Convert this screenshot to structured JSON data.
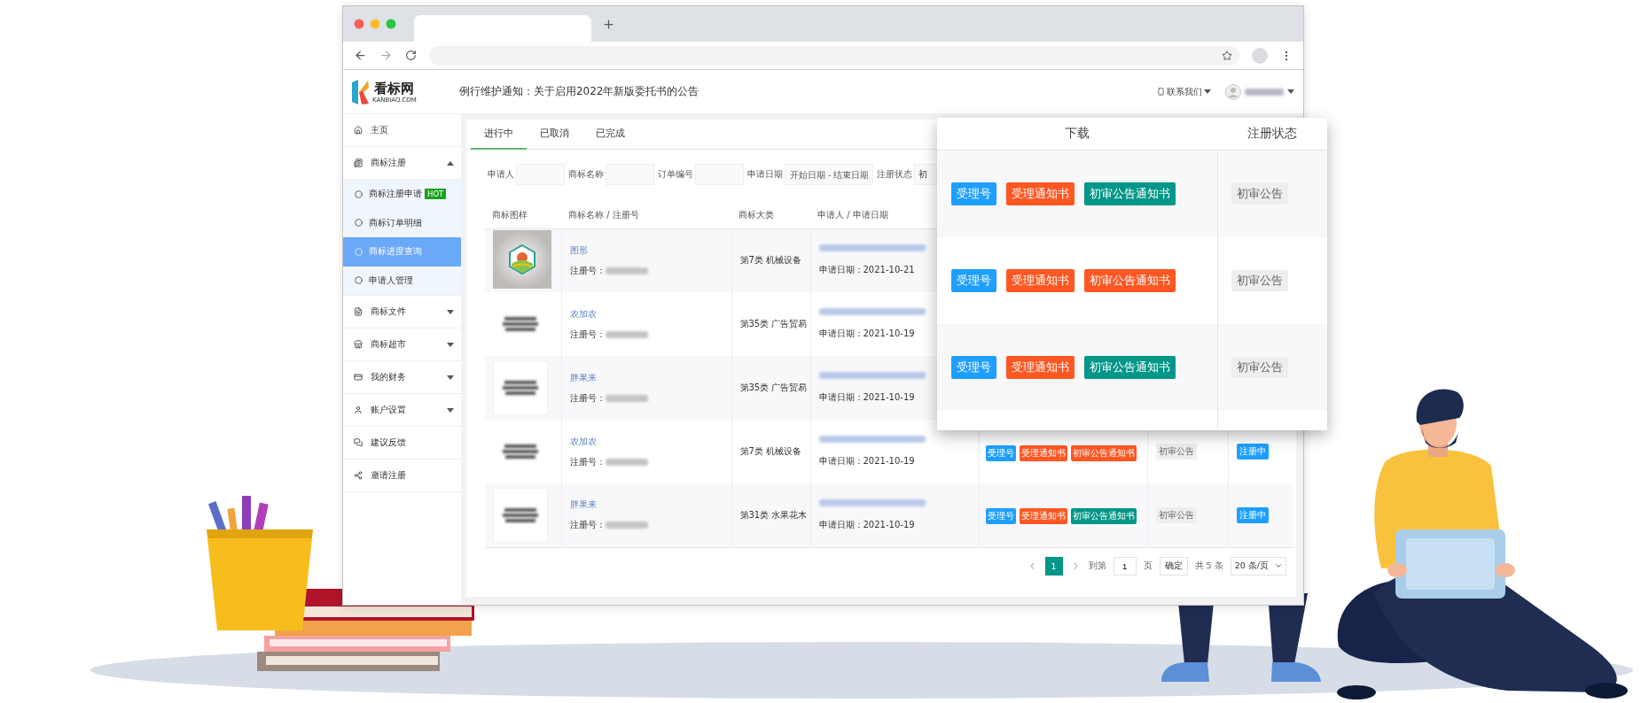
{
  "header": {
    "logo_title": "看标网",
    "logo_subtitle": "KANBIAO.COM",
    "notice": "例行维护通知：关于启用2022年新版委托书的公告",
    "contact": "联系我们"
  },
  "sidebar": {
    "items": [
      {
        "label": "主页",
        "selected": false
      },
      {
        "label": "商标注册",
        "selected": false,
        "expanded": true,
        "children": [
          {
            "label": "商标注册申请",
            "selected": false,
            "badge": "HOT"
          },
          {
            "label": "商标订单明细",
            "selected": false
          },
          {
            "label": "商标进度查询",
            "selected": true
          },
          {
            "label": "申请人管理",
            "selected": false
          }
        ]
      },
      {
        "label": "商标文件",
        "selected": false,
        "expanded": false
      },
      {
        "label": "商标超市",
        "selected": false,
        "expanded": false
      },
      {
        "label": "我的财务",
        "selected": false,
        "expanded": false
      },
      {
        "label": "账户设置",
        "selected": false,
        "expanded": false
      },
      {
        "label": "建议反馈",
        "selected": false
      },
      {
        "label": "邀请注册",
        "selected": false
      }
    ]
  },
  "tabs": [
    {
      "label": "进行中",
      "selected": true
    },
    {
      "label": "已取消",
      "selected": false
    },
    {
      "label": "已完成",
      "selected": false
    }
  ],
  "filters": [
    {
      "label": "申请人",
      "kind": "text"
    },
    {
      "label": "商标名称",
      "kind": "text"
    },
    {
      "label": "订单编号",
      "kind": "text"
    },
    {
      "label": "申请日期",
      "kind": "date",
      "placeholder": "开始日期 - 结束日期"
    },
    {
      "label": "注册状态",
      "kind": "select",
      "value": "初"
    }
  ],
  "table": {
    "columns": [
      "商标图样",
      "商标名称 / 注册号",
      "商标大类",
      "申请人 / 申请日期"
    ],
    "rows": [
      {
        "kind": "logo",
        "name": "图形",
        "reg_label": "注册号：",
        "category": "第7类 机械设备",
        "date": "申请日期：2021-10-21"
      },
      {
        "kind": "blurred",
        "name": "农加农",
        "reg_label": "注册号：",
        "category": "第35类 广告贸易",
        "date": "申请日期：2021-10-19"
      },
      {
        "kind": "blurred_framed",
        "name": "胖果来",
        "reg_label": "注册号：",
        "category": "第35类 广告贸易",
        "date": "申请日期：2021-10-19"
      },
      {
        "kind": "blurred",
        "name": "农加农",
        "reg_label": "注册号：",
        "category": "第7类 机械设备",
        "date": "申请日期：2021-10-19",
        "downloads": [
          {
            "label": "受理号",
            "color": "#1e9fff"
          },
          {
            "label": "受理通知书",
            "color": "#ff5722"
          },
          {
            "label": "初审公告通知书",
            "color": "#ff5722"
          }
        ],
        "status": "初审公告",
        "reg_status": "注册中"
      },
      {
        "kind": "blurred_framed",
        "name": "胖果来",
        "reg_label": "注册号：",
        "category": "第31类 水果花木",
        "date": "申请日期：2021-10-19",
        "downloads": [
          {
            "label": "受理号",
            "color": "#1e9fff"
          },
          {
            "label": "受理通知书",
            "color": "#ff5722"
          },
          {
            "label": "初审公告通知书",
            "color": "#009688"
          }
        ],
        "status": "初审公告",
        "reg_status": "注册中"
      }
    ]
  },
  "pagination": {
    "pages": [
      {
        "label": "1",
        "selected": true
      }
    ],
    "goto_label": "到第",
    "goto_value": "1",
    "page_unit": "页",
    "confirm": "确定",
    "total": "共 5 条",
    "page_size": "20 条/页"
  },
  "popup": {
    "columns": [
      "下载",
      "注册状态"
    ],
    "rows": [
      {
        "downloads": [
          {
            "label": "受理号",
            "color": "#1e9fff"
          },
          {
            "label": "受理通知书",
            "color": "#ff5722"
          },
          {
            "label": "初审公告通知书",
            "color": "#009688"
          }
        ],
        "status": "初审公告"
      },
      {
        "downloads": [
          {
            "label": "受理号",
            "color": "#1e9fff"
          },
          {
            "label": "受理通知书",
            "color": "#ff5722"
          },
          {
            "label": "初审公告通知书",
            "color": "#ff5722"
          }
        ],
        "status": "初审公告"
      },
      {
        "downloads": [
          {
            "label": "受理号",
            "color": "#1e9fff"
          },
          {
            "label": "受理通知书",
            "color": "#ff5722"
          },
          {
            "label": "初审公告通知书",
            "color": "#009688"
          }
        ],
        "status": "初审公告"
      }
    ]
  }
}
